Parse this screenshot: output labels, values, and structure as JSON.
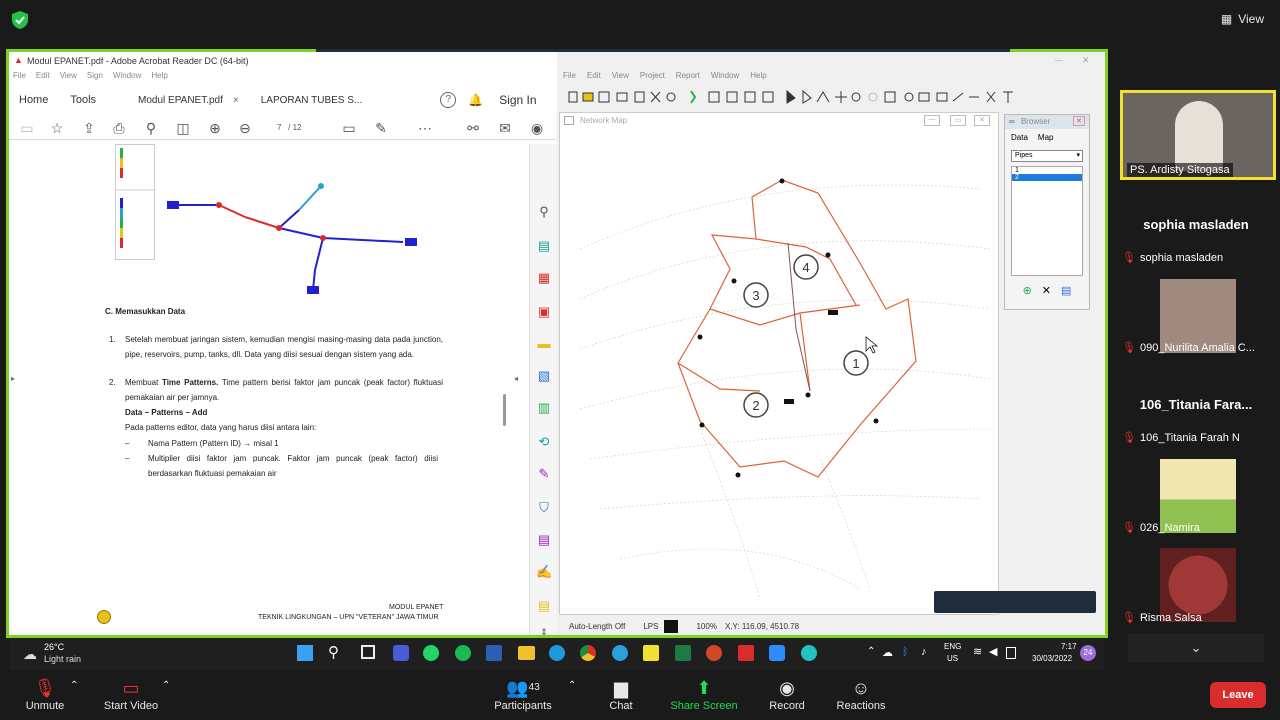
{
  "zoom": {
    "view_label": "View",
    "mic_label": "Unmute",
    "video_label": "Start Video",
    "participants_label": "Participants",
    "participants_count": "43",
    "chat_label": "Chat",
    "share_label": "Share Screen",
    "record_label": "Record",
    "reactions_label": "Reactions",
    "leave_label": "Leave"
  },
  "participants": [
    {
      "name": "PS. Ardisty Sitogasa",
      "active": true
    },
    {
      "name": "sophia masladen",
      "big_name": "sophia masladen"
    },
    {
      "name": "090_Nurilita Amalia C..."
    },
    {
      "name": "106_Titania Farah N",
      "big_name": "106_Titania Fara..."
    },
    {
      "name": "026_Namira"
    },
    {
      "name": "Risma Salsa"
    }
  ],
  "acrobat": {
    "title": "Modul EPANET.pdf - Adobe Acrobat Reader DC (64-bit)",
    "menu": [
      "File",
      "Edit",
      "View",
      "Sign",
      "Window",
      "Help"
    ],
    "tabs": {
      "home": "Home",
      "tools": "Tools",
      "doc1": "Modul EPANET.pdf",
      "doc2": "LAPORAN TUBES S..."
    },
    "sign_in": "Sign In",
    "page_current": "7",
    "page_total": "/ 12",
    "doc": {
      "section": "C. Memasukkan Data",
      "item1_num": "1.",
      "item1": "Setelah membuat jaringan sistem, kemudian mengisi masing-masing data pada junction, pipe, reservoirs, pump, tanks, dll. Data yang diisi sesuai dengan sistem yang ada.",
      "item2_num": "2.",
      "item2_a": "Membuat ",
      "item2_b": "Time Patterns.",
      "item2_c": " Time pattern berisi faktor jam puncak (peak factor) fluktuasi pemakaian air per jamnya.",
      "sub_heading": "Data – Patterns – Add",
      "sub_intro": "Pada patterns editor, data yang harus diisi antara lain:",
      "bullet1": "Nama Pattern (Pattern ID) → misal 1",
      "bullet2": "Multiplier diisi faktor jam puncak. Faktor jam puncak (peak factor) diisi berdasarkan fluktuasi pemakaian air",
      "footer1": "MODUL EPANET",
      "footer2": "TEKNIK LINGKUNGAN – UPN \"VETERAN\" JAWA TIMUR"
    }
  },
  "epanet": {
    "menu": [
      "File",
      "Edit",
      "View",
      "Project",
      "Report",
      "Window",
      "Help"
    ],
    "map_title": "Network Map",
    "browser": {
      "title": "Browser",
      "tab_data": "Data",
      "tab_map": "Map",
      "category": "Pipes",
      "items": [
        "1",
        "2"
      ]
    },
    "status": {
      "auto_length": "Auto-Length Off",
      "units": "LPS",
      "zoom": "100%",
      "xy": "X,Y: 116.09, 4510.78"
    },
    "zones": [
      "1",
      "2",
      "3",
      "4"
    ]
  },
  "taskbar": {
    "weather_temp": "26°C",
    "weather_desc": "Light rain",
    "lang1": "ENG",
    "lang2": "US",
    "time": "7:17",
    "date": "30/03/2022",
    "notif": "24"
  },
  "colors": {
    "share_border": "#7ed321",
    "leave": "#d92d2d",
    "share_icon": "#23d959",
    "pipe_red": "#e0603a"
  }
}
